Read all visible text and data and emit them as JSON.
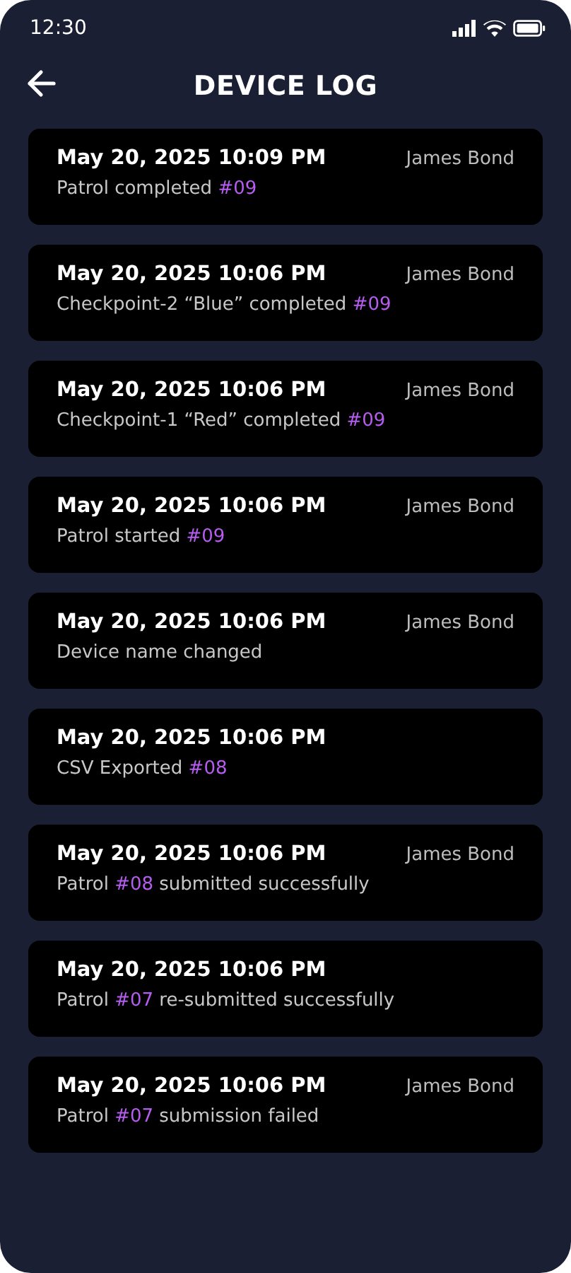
{
  "status_bar": {
    "time": "12:30"
  },
  "header": {
    "title": "DEVICE LOG"
  },
  "entries": [
    {
      "timestamp": "May 20, 2025 10:09 PM",
      "user": "James Bond",
      "message": [
        {
          "kind": "text",
          "text": "Patrol completed "
        },
        {
          "kind": "tag",
          "text": "#09"
        }
      ]
    },
    {
      "timestamp": "May 20, 2025 10:06 PM",
      "user": "James Bond",
      "message": [
        {
          "kind": "text",
          "text": "Checkpoint-2 “Blue” completed "
        },
        {
          "kind": "tag",
          "text": "#09"
        }
      ]
    },
    {
      "timestamp": "May 20, 2025 10:06 PM",
      "user": "James Bond",
      "message": [
        {
          "kind": "text",
          "text": "Checkpoint-1 “Red” completed "
        },
        {
          "kind": "tag",
          "text": "#09"
        }
      ]
    },
    {
      "timestamp": "May 20, 2025 10:06 PM",
      "user": "James Bond",
      "message": [
        {
          "kind": "text",
          "text": "Patrol started "
        },
        {
          "kind": "tag",
          "text": "#09"
        }
      ]
    },
    {
      "timestamp": "May 20, 2025 10:06 PM",
      "user": "James Bond",
      "message": [
        {
          "kind": "text",
          "text": "Device name changed"
        }
      ]
    },
    {
      "timestamp": "May 20, 2025 10:06 PM",
      "message": [
        {
          "kind": "text",
          "text": "CSV Exported "
        },
        {
          "kind": "tag",
          "text": "#08"
        }
      ]
    },
    {
      "timestamp": "May 20, 2025 10:06 PM",
      "user": "James Bond",
      "message": [
        {
          "kind": "text",
          "text": "Patrol "
        },
        {
          "kind": "tag",
          "text": "#08"
        },
        {
          "kind": "text",
          "text": " submitted successfully"
        }
      ]
    },
    {
      "timestamp": "May 20, 2025 10:06 PM",
      "message": [
        {
          "kind": "text",
          "text": "Patrol "
        },
        {
          "kind": "tag",
          "text": "#07"
        },
        {
          "kind": "text",
          "text": " re-submitted successfully"
        }
      ]
    },
    {
      "timestamp": "May 20, 2025 10:06 PM",
      "user": "James Bond",
      "message": [
        {
          "kind": "text",
          "text": "Patrol "
        },
        {
          "kind": "tag",
          "text": "#07"
        },
        {
          "kind": "text",
          "text": " submission failed"
        }
      ]
    }
  ]
}
